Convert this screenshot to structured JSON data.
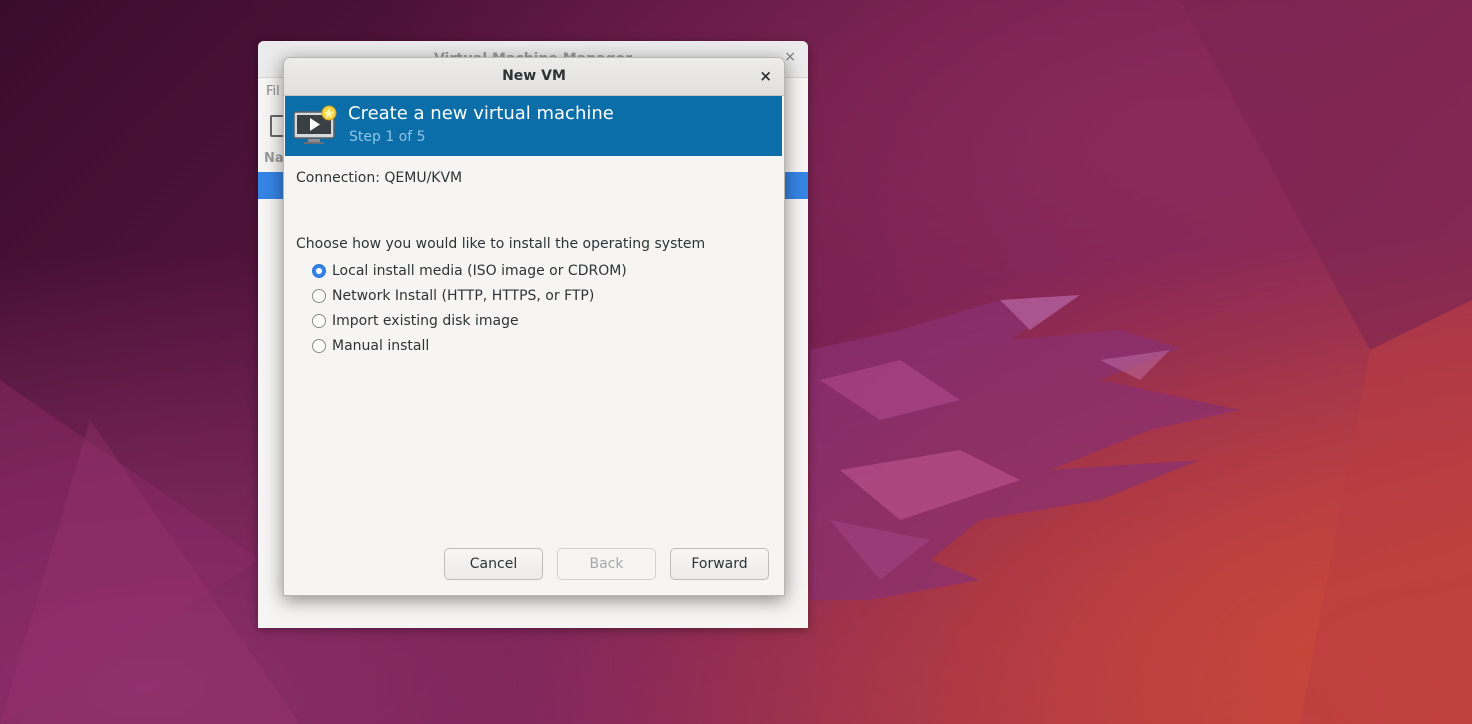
{
  "wallpaper": {
    "name": "ubuntu-wallpaper"
  },
  "background_window": {
    "title": "Virtual Machine Manager",
    "close_glyph": "×",
    "menu_partial": "Fil",
    "column_partial": "Na"
  },
  "dialog": {
    "title": "New VM",
    "close_glyph": "×",
    "banner": {
      "icon": "vm-monitor-icon",
      "title": "Create a new virtual machine",
      "step": "Step 1 of 5"
    },
    "connection": "Connection: QEMU/KVM",
    "prompt": "Choose how you would like to install the operating system",
    "options": [
      {
        "label": "Local install media (ISO image or CDROM)",
        "checked": true
      },
      {
        "label": "Network Install (HTTP, HTTPS, or FTP)",
        "checked": false
      },
      {
        "label": "Import existing disk image",
        "checked": false
      },
      {
        "label": "Manual install",
        "checked": false
      }
    ],
    "buttons": {
      "cancel": "Cancel",
      "back": "Back",
      "forward": "Forward"
    }
  },
  "colors": {
    "banner": "#0b6ea8",
    "selection": "#3584e4"
  }
}
